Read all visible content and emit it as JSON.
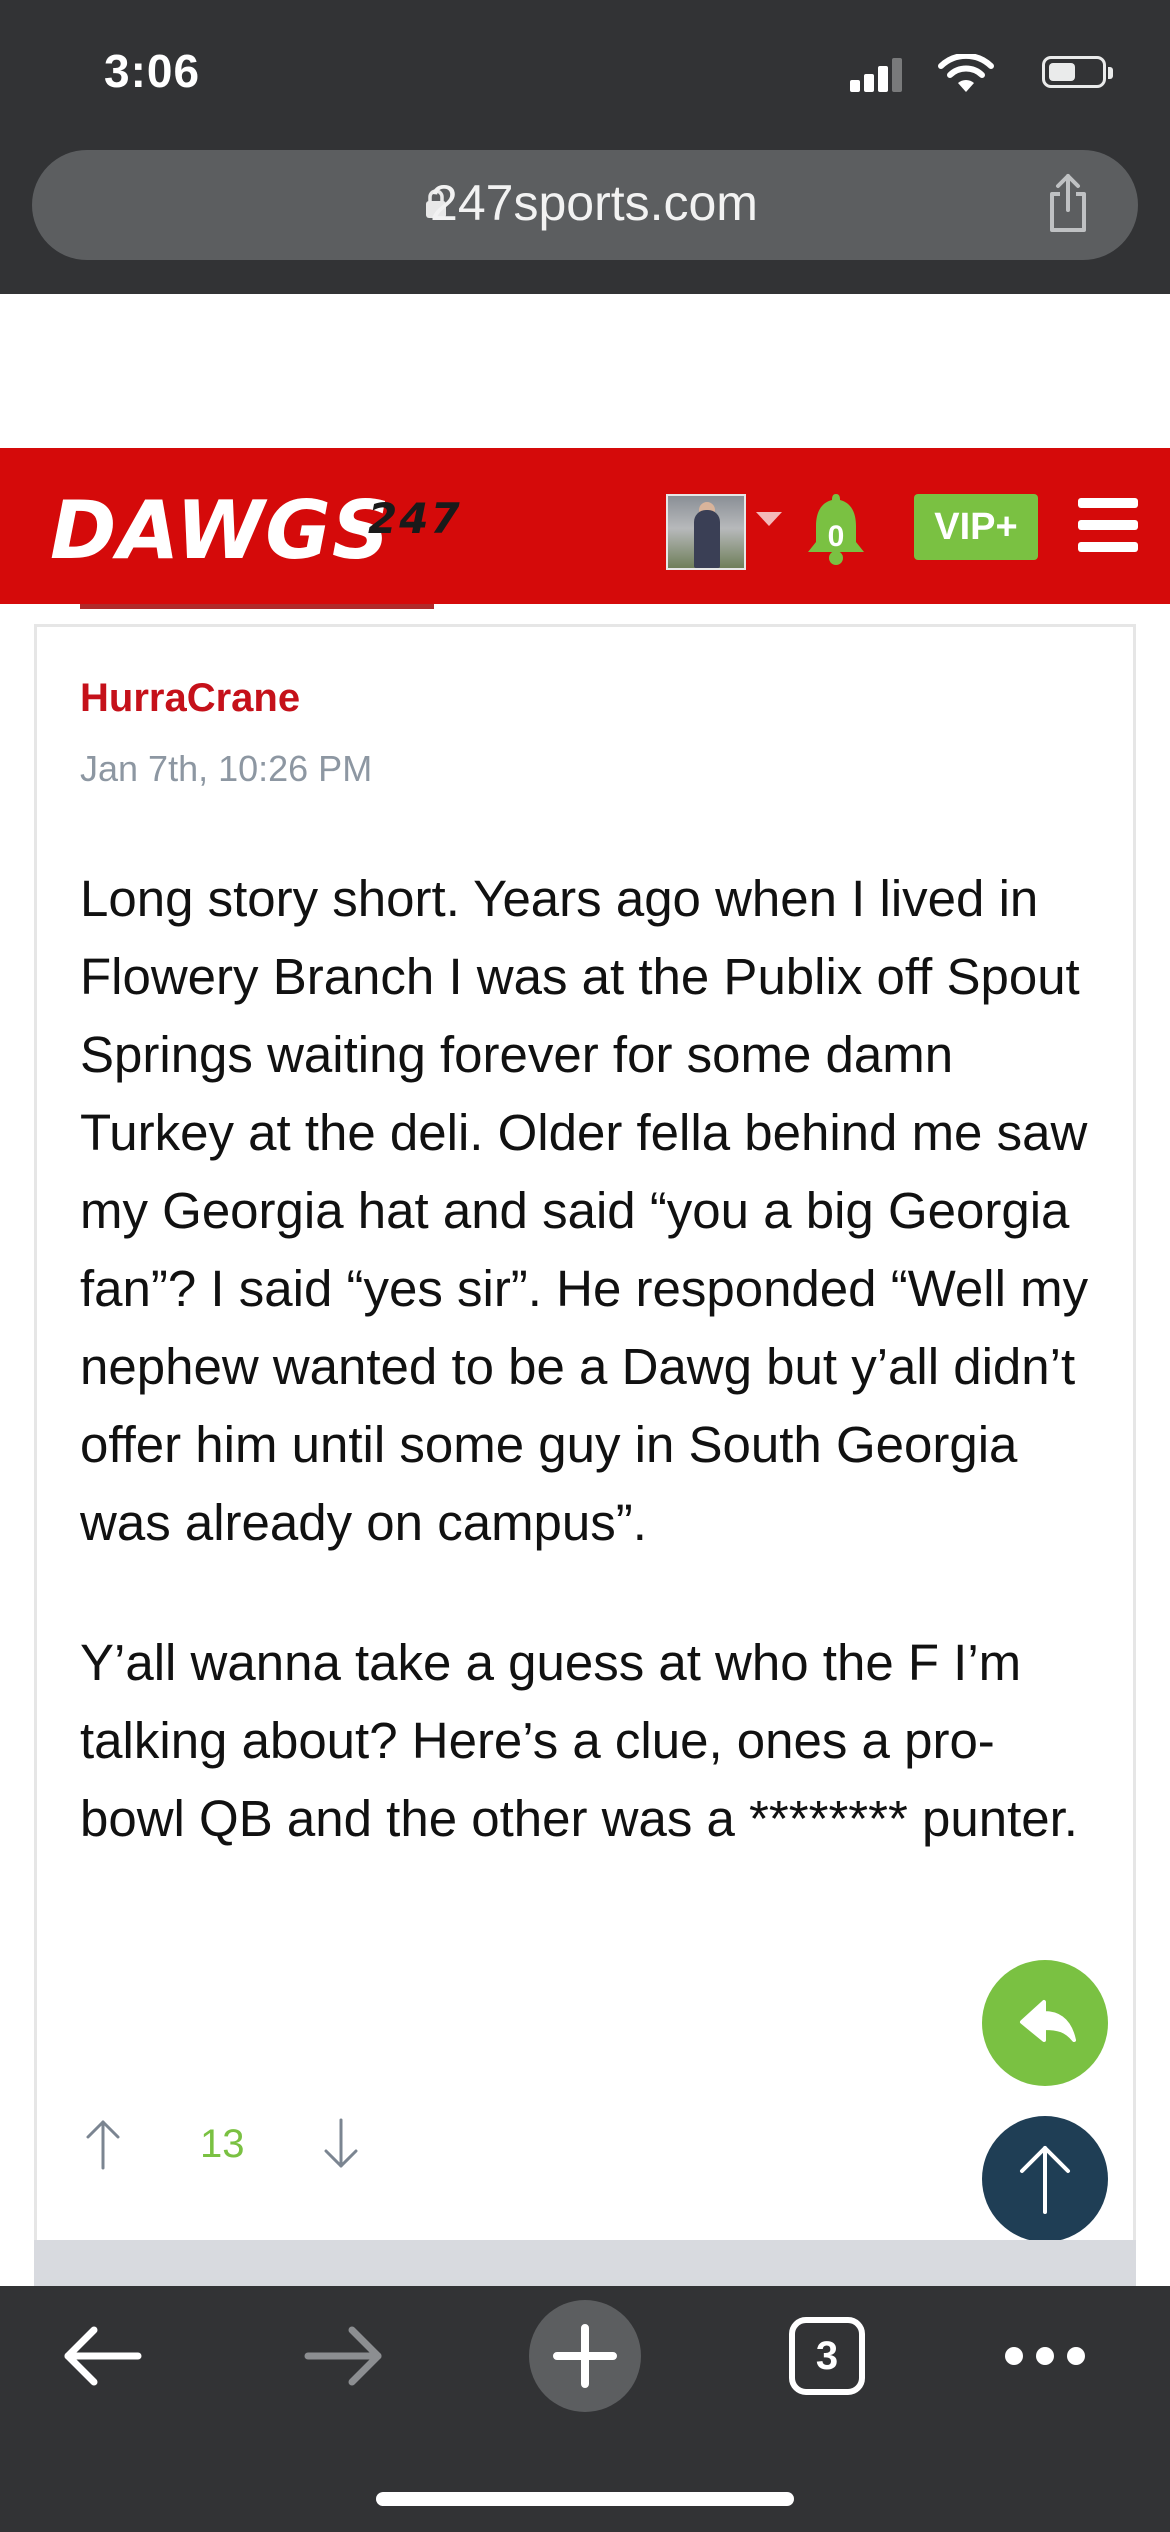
{
  "status_bar": {
    "time": "3:06"
  },
  "browser": {
    "url": "247sports.com",
    "tab_count": "3",
    "icons": [
      "lock-icon",
      "share-icon",
      "back-icon",
      "forward-icon",
      "new-tab-icon",
      "tabs-icon",
      "more-icon"
    ]
  },
  "site_header": {
    "logo_text": "DAWGS",
    "logo_number": "247",
    "notification_count": "0",
    "vip_label": "VIP+",
    "accent_color": "#d50a0a",
    "vip_color": "#7ac142"
  },
  "post": {
    "author": "HurraCrane",
    "timestamp": "Jan 7th, 10:26 PM",
    "paragraphs": [
      "Long story short. Years ago when I lived in Flowery Branch I was at the Publix off Spout Springs waiting forever for some damn Turkey at the deli. Older fella behind me saw my Georgia hat and said “you a big Georgia fan”? I said “yes sir”. He responded “Well my nephew wanted to be a Dawg but y’all didn’t offer him until some guy in South Georgia was already on campus”.",
      "Y’all wanna take a guess at who the F I’m talking about? Here’s a clue, ones a pro-bowl QB and the other was a ******** punter."
    ],
    "vote_count": "13"
  }
}
